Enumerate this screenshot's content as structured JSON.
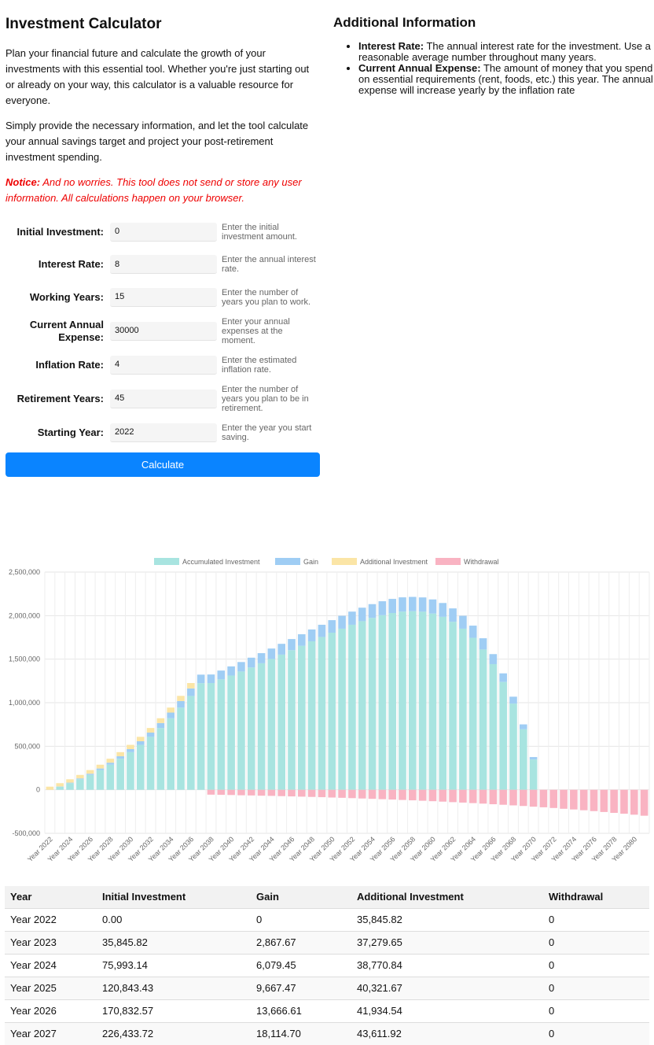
{
  "title": "Investment Calculator",
  "intro": "Plan your financial future and calculate the growth of your investments with this essential tool. Whether you're just starting out or already on your way, this calculator is a valuable resource for everyone.",
  "intro2": "Simply provide the necessary information, and let the tool calculate your annual savings target and project your post-retirement investment spending.",
  "notice": {
    "label": "Notice:",
    "text": "And no worries. This tool does not send or store any user information. All calculations happen on your browser."
  },
  "form": {
    "initial": {
      "label": "Initial Investment:",
      "value": "0",
      "hint": "Enter the initial investment amount."
    },
    "rate": {
      "label": "Interest Rate:",
      "value": "8",
      "hint": "Enter the annual interest rate."
    },
    "working": {
      "label": "Working Years:",
      "value": "15",
      "hint": "Enter the number of years you plan to work."
    },
    "expense": {
      "label": "Current Annual Expense:",
      "value": "30000",
      "hint": "Enter your annual expenses at the moment."
    },
    "inflation": {
      "label": "Inflation Rate:",
      "value": "4",
      "hint": "Enter the estimated inflation rate."
    },
    "retire": {
      "label": "Retirement Years:",
      "value": "45",
      "hint": "Enter the number of years you plan to be in retirement."
    },
    "start": {
      "label": "Starting Year:",
      "value": "2022",
      "hint": "Enter the year you start saving."
    },
    "calculate": "Calculate"
  },
  "info": {
    "title": "Additional Information",
    "items": [
      {
        "term": "Interest Rate:",
        "text": "The annual interest rate for the investment. Use a reasonable average number throughout many years."
      },
      {
        "term": "Current Annual Expense:",
        "text": "The amount of money that you spend on essential requirements (rent, foods, etc.) this year. The annual expense will increase yearly by the inflation rate"
      }
    ]
  },
  "colors": {
    "accumulated": "#a8e4e0",
    "gain": "#9fcdf4",
    "additional": "#fbe5a6",
    "withdrawal": "#f9b3c2",
    "button": "#0a84ff"
  },
  "chart_data": {
    "type": "bar",
    "stacked": true,
    "ylim": [
      -500000,
      2500000
    ],
    "yticks": [
      "2,500,000",
      "2,000,000",
      "1,500,000",
      "1,000,000",
      "500,000",
      "0",
      "-500,000"
    ],
    "xticks": [
      "Year 2022",
      "Year 2024",
      "Year 2026",
      "Year 2028",
      "Year 2030",
      "Year 2032",
      "Year 2034",
      "Year 2036",
      "Year 2038",
      "Year 2040",
      "Year 2042",
      "Year 2044",
      "Year 2046",
      "Year 2048",
      "Year 2050",
      "Year 2052",
      "Year 2054",
      "Year 2056",
      "Year 2058",
      "Year 2060",
      "Year 2062",
      "Year 2064",
      "Year 2066",
      "Year 2068",
      "Year 2070",
      "Year 2072",
      "Year 2074",
      "Year 2076",
      "Year 2078",
      "Year 2080"
    ],
    "legend_position": "top",
    "series": [
      {
        "name": "Accumulated Investment",
        "values": [
          0,
          35846,
          75993,
          120843,
          170833,
          226434,
          288179,
          356610,
          432323,
          515945,
          608134,
          709597,
          821087,
          943425,
          1077487,
          1224221,
          1226000,
          1268000,
          1312000,
          1358000,
          1405000,
          1453000,
          1502000,
          1552000,
          1603000,
          1654000,
          1705000,
          1755000,
          1804000,
          1850000,
          1895000,
          1936000,
          1974000,
          2005000,
          2030000,
          2046000,
          2051000,
          2045000,
          2024000,
          1986000,
          1929000,
          1850000,
          1745000,
          1611000,
          1443000,
          1238000,
          990000,
          695000,
          348000
        ]
      },
      {
        "name": "Gain",
        "values": [
          0,
          2868,
          6079,
          9667,
          13667,
          18115,
          23054,
          28529,
          34586,
          41276,
          48651,
          56768,
          65687,
          75474,
          86199,
          97938,
          98000,
          101000,
          105000,
          109000,
          112000,
          116000,
          120000,
          124000,
          128000,
          132000,
          136000,
          140000,
          144000,
          148000,
          151000,
          155000,
          158000,
          160000,
          162000,
          164000,
          164000,
          164000,
          162000,
          159000,
          154000,
          148000,
          140000,
          129000,
          115000,
          99000,
          79000,
          56000,
          28000
        ]
      },
      {
        "name": "Additional Investment",
        "values": [
          35846,
          37280,
          38771,
          40322,
          41935,
          43612,
          45357,
          47171,
          49058,
          51020,
          53061,
          55183,
          57391,
          59686,
          62074,
          0,
          0,
          0,
          0,
          0,
          0,
          0,
          0,
          0,
          0,
          0,
          0,
          0,
          0,
          0,
          0,
          0,
          0,
          0,
          0,
          0,
          0,
          0,
          0,
          0,
          0,
          0,
          0,
          0,
          0,
          0,
          0,
          0,
          0
        ]
      },
      {
        "name": "Withdrawal",
        "values": [
          0,
          0,
          0,
          0,
          0,
          0,
          0,
          0,
          0,
          0,
          0,
          0,
          0,
          0,
          0,
          0,
          -56000,
          -58000,
          -60000,
          -63000,
          -65000,
          -68000,
          -70000,
          -73000,
          -76000,
          -79000,
          -82000,
          -85000,
          -89000,
          -92000,
          -96000,
          -100000,
          -104000,
          -108000,
          -112000,
          -117000,
          -121000,
          -126000,
          -131000,
          -136000,
          -142000,
          -147000,
          -153000,
          -159000,
          -166000,
          -172000,
          -179000,
          -186000,
          -194000,
          -201000,
          -209000,
          -218000,
          -226000,
          -235000,
          -245000,
          -255000,
          -265000,
          -275000,
          -286000,
          -298000
        ]
      }
    ]
  },
  "table": {
    "headers": [
      "Year",
      "Initial Investment",
      "Gain",
      "Additional Investment",
      "Withdrawal"
    ],
    "rows": [
      [
        "Year 2022",
        "0.00",
        "0",
        "35,845.82",
        "0"
      ],
      [
        "Year 2023",
        "35,845.82",
        "2,867.67",
        "37,279.65",
        "0"
      ],
      [
        "Year 2024",
        "75,993.14",
        "6,079.45",
        "38,770.84",
        "0"
      ],
      [
        "Year 2025",
        "120,843.43",
        "9,667.47",
        "40,321.67",
        "0"
      ],
      [
        "Year 2026",
        "170,832.57",
        "13,666.61",
        "41,934.54",
        "0"
      ],
      [
        "Year 2027",
        "226,433.72",
        "18,114.70",
        "43,611.92",
        "0"
      ]
    ]
  }
}
